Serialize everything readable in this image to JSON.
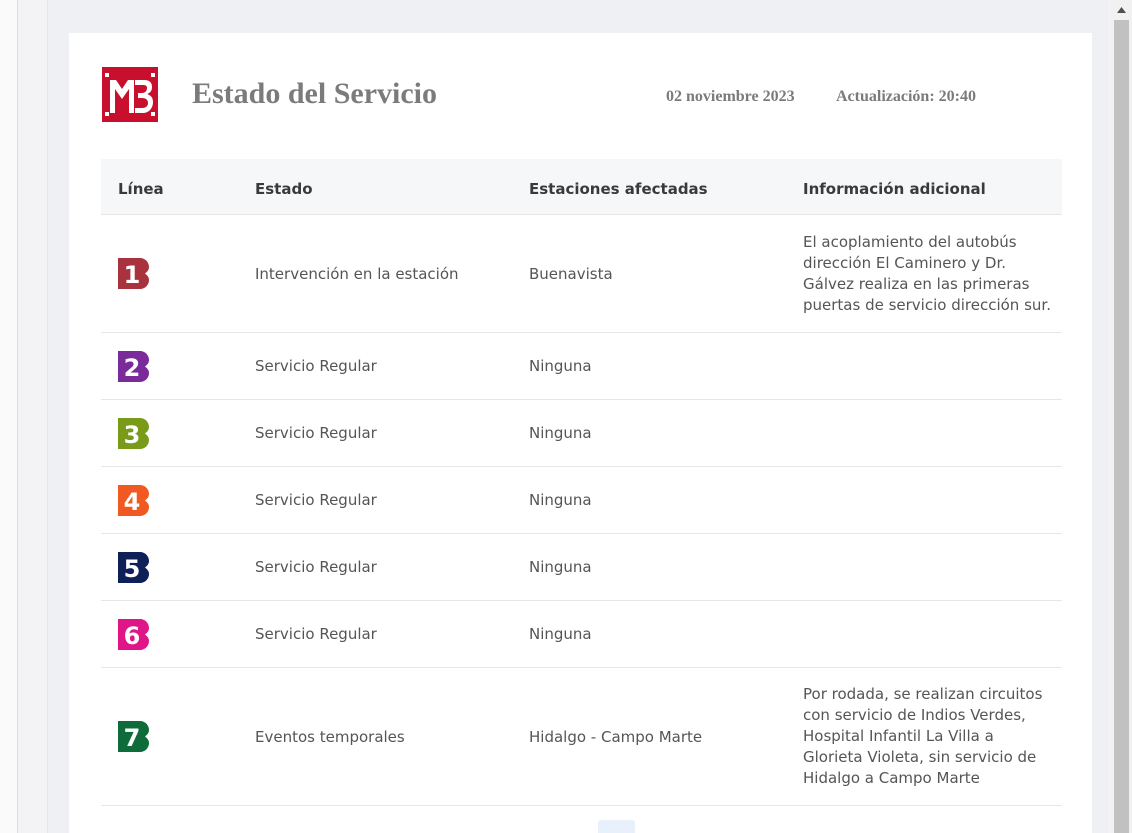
{
  "header": {
    "title": "Estado del Servicio",
    "date": "02 noviembre 2023",
    "update": "Actualización: 20:40",
    "logo_color": "#c8102e"
  },
  "table": {
    "columns": [
      "Línea",
      "Estado",
      "Estaciones afectadas",
      "Información adicional"
    ],
    "rows": [
      {
        "line": "1",
        "color": "#a8323e",
        "status": "Intervención en la estación",
        "stations": "Buenavista",
        "info": "El acoplamiento del autobús dirección El Caminero y Dr. Gálvez realiza en las primeras puertas de servicio dirección sur."
      },
      {
        "line": "2",
        "color": "#7b2a9a",
        "status": "Servicio Regular",
        "stations": "Ninguna",
        "info": ""
      },
      {
        "line": "3",
        "color": "#7a9b1a",
        "status": "Servicio Regular",
        "stations": "Ninguna",
        "info": ""
      },
      {
        "line": "4",
        "color": "#f05a22",
        "status": "Servicio Regular",
        "stations": "Ninguna",
        "info": ""
      },
      {
        "line": "5",
        "color": "#0f1f58",
        "status": "Servicio Regular",
        "stations": "Ninguna",
        "info": ""
      },
      {
        "line": "6",
        "color": "#e01587",
        "status": "Servicio Regular",
        "stations": "Ninguna",
        "info": ""
      },
      {
        "line": "7",
        "color": "#0f6b3a",
        "status": "Eventos temporales",
        "stations": "Hidalgo - Campo Marte",
        "info": "Por rodada, se realizan circuitos con servicio de Indios Verdes, Hospital Infantil La Villa a Glorieta Violeta, sin servicio de Hidalgo a Campo Marte"
      }
    ]
  }
}
